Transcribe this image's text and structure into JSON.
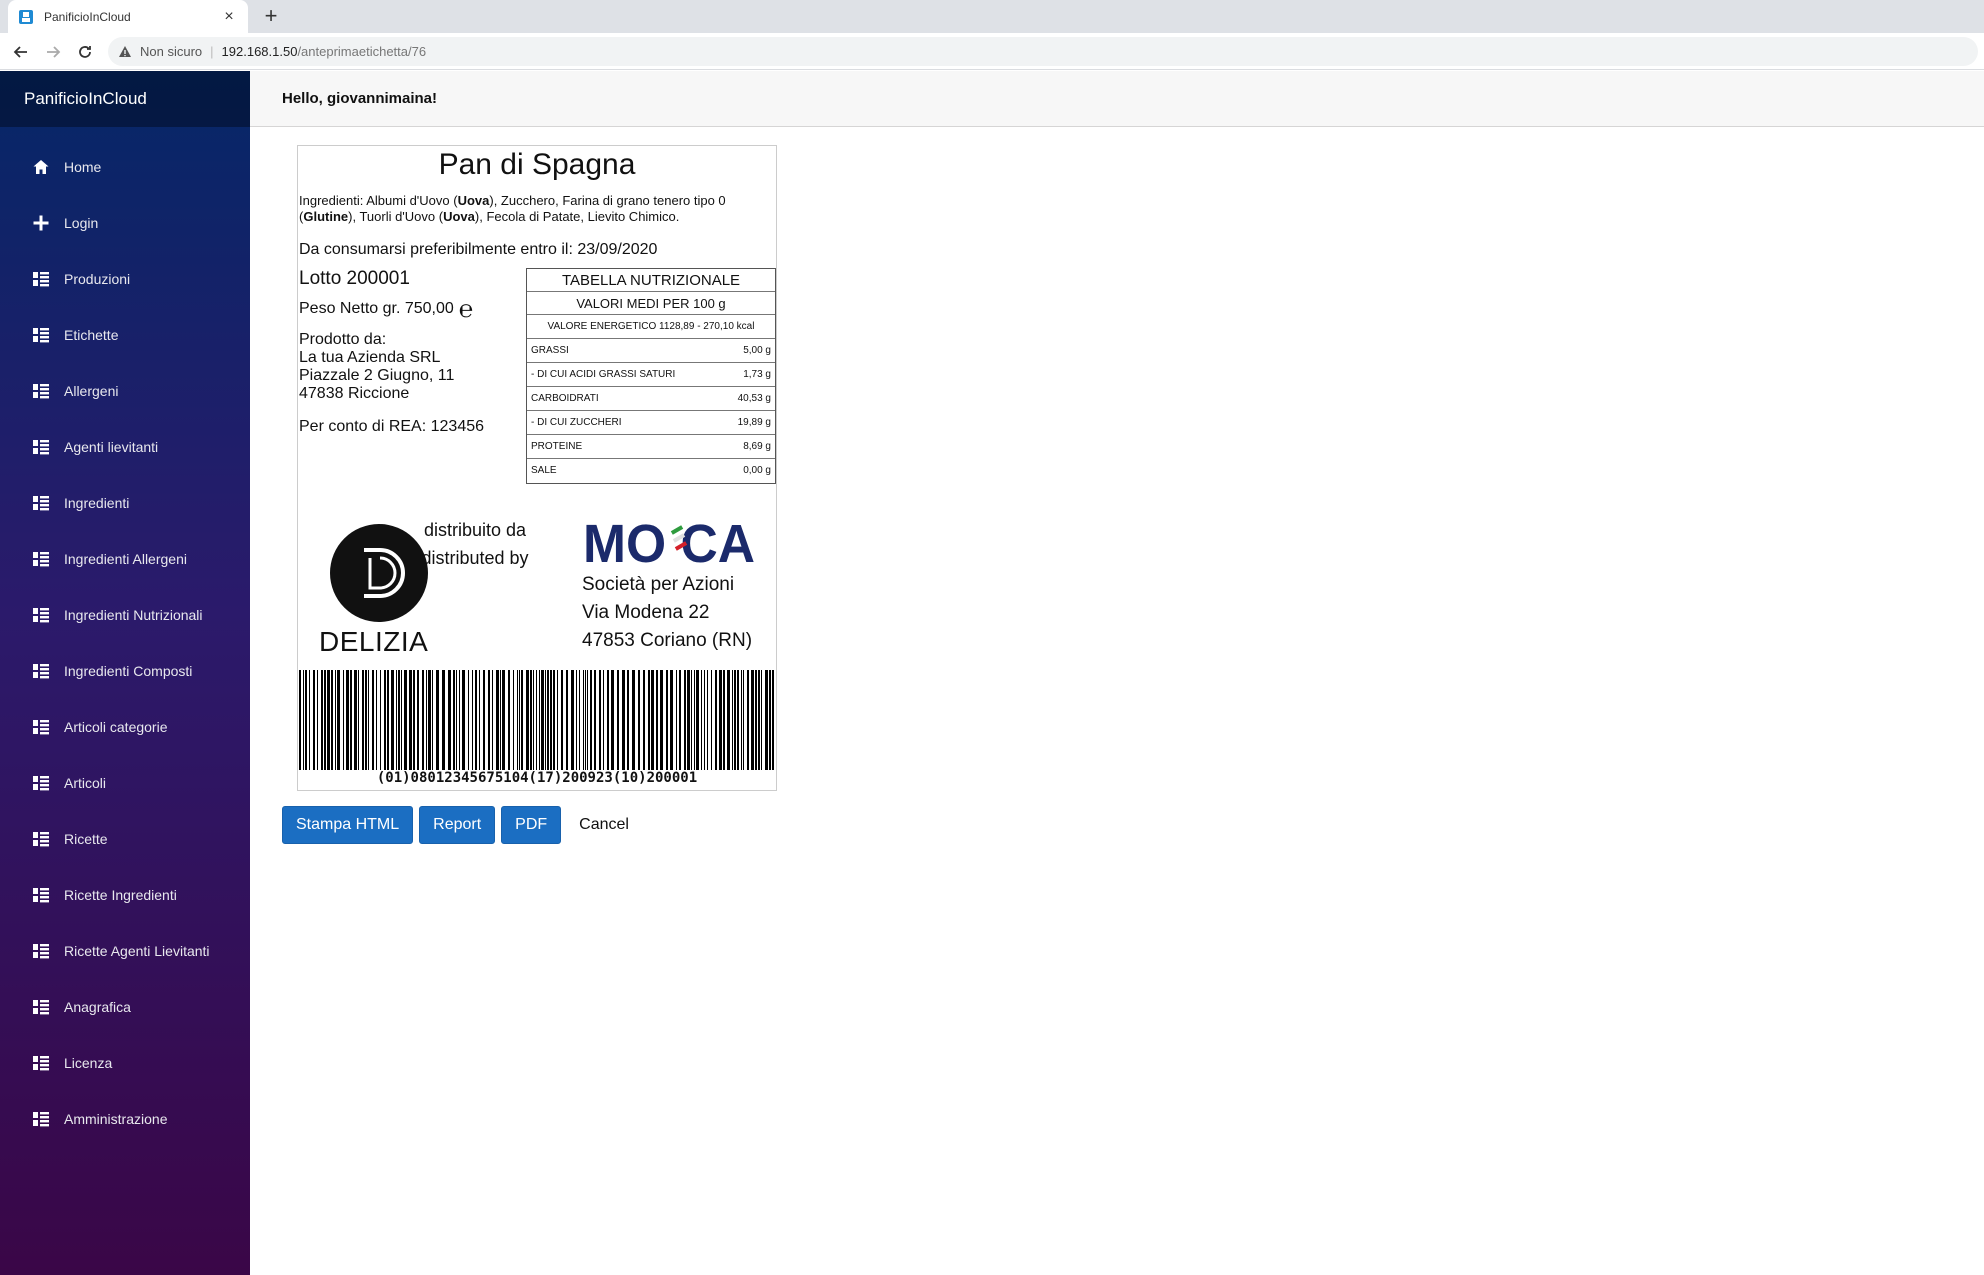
{
  "browser": {
    "tab_title": "PanificioInCloud",
    "tab_close": "×",
    "new_tab": "+",
    "security_label": "Non sicuro",
    "url_host": "192.168.1.50",
    "url_path": "/anteprimaetichetta/76"
  },
  "sidebar": {
    "brand": "PanificioInCloud",
    "items": [
      {
        "label": "Home",
        "icon": "home-icon"
      },
      {
        "label": "Login",
        "icon": "plus-icon"
      },
      {
        "label": "Produzioni",
        "icon": "list-icon"
      },
      {
        "label": "Etichette",
        "icon": "list-icon"
      },
      {
        "label": "Allergeni",
        "icon": "list-icon"
      },
      {
        "label": "Agenti lievitanti",
        "icon": "list-icon"
      },
      {
        "label": "Ingredienti",
        "icon": "list-icon"
      },
      {
        "label": "Ingredienti Allergeni",
        "icon": "list-icon"
      },
      {
        "label": "Ingredienti Nutrizionali",
        "icon": "list-icon"
      },
      {
        "label": "Ingredienti Composti",
        "icon": "list-icon"
      },
      {
        "label": "Articoli categorie",
        "icon": "list-icon"
      },
      {
        "label": "Articoli",
        "icon": "list-icon"
      },
      {
        "label": "Ricette",
        "icon": "list-icon"
      },
      {
        "label": "Ricette Ingredienti",
        "icon": "list-icon"
      },
      {
        "label": "Ricette Agenti Lievitanti",
        "icon": "list-icon"
      },
      {
        "label": "Anagrafica",
        "icon": "list-icon"
      },
      {
        "label": "Licenza",
        "icon": "list-icon"
      },
      {
        "label": "Amministrazione",
        "icon": "list-icon"
      }
    ]
  },
  "header": {
    "greeting": "Hello, giovannimaina!"
  },
  "label": {
    "product_name": "Pan di Spagna",
    "ingredients": {
      "prefix": "Ingredienti: Albumi d'Uovo (",
      "a1": "Uova",
      "t1": "), Zucchero, Farina di grano tenero tipo 0 (",
      "a2": "Glutine",
      "t2": "), Tuorli d'Uovo (",
      "a3": "Uova",
      "t3": "), Fecola di Patate, Lievito Chimico."
    },
    "expiry": "Da consumarsi preferibilmente entro il: 23/09/2020",
    "lot": "Lotto 200001",
    "weight": "Peso Netto gr. 750,00",
    "e_mark": "℮",
    "producer": {
      "heading": "Prodotto da:",
      "name": "La tua Azienda SRL",
      "street": "Piazzale 2 Giugno, 11",
      "city": "47838 Riccione"
    },
    "rea": "Per conto di REA: 123456",
    "nutrition": {
      "title": "TABELLA NUTRIZIONALE",
      "subtitle": "VALORI MEDI PER 100 g",
      "energy": "VALORE ENERGETICO 1128,89 - 270,10 kcal",
      "rows": [
        {
          "name": "GRASSI",
          "value": "5,00 g"
        },
        {
          "name": "- DI CUI ACIDI GRASSI SATURI",
          "value": "1,73 g"
        },
        {
          "name": "CARBOIDRATI",
          "value": "40,53 g"
        },
        {
          "name": "- DI CUI ZUCCHERI",
          "value": "19,89 g"
        },
        {
          "name": "PROTEINE",
          "value": "8,69 g"
        },
        {
          "name": "SALE",
          "value": "0,00 g"
        }
      ]
    },
    "brand_delizia": "DELIZIA",
    "distributed_it": "distribuito da",
    "distributed_en": "distributed by",
    "distributor": {
      "logo_text": "MOCA",
      "line1": "Società per Azioni",
      "line2": "Via Modena 22",
      "line3": "47853 Coriano (RN)"
    },
    "barcode_text": "(01)08012345675104(17)200923(10)200001"
  },
  "actions": {
    "stampa_html": "Stampa HTML",
    "report": "Report",
    "pdf": "PDF",
    "cancel": "Cancel"
  },
  "colors": {
    "primary_button": "#1b6ec2",
    "sidebar_top": "#052767",
    "sidebar_bottom": "#3a0647",
    "moca_blue": "#1b2a6b"
  }
}
